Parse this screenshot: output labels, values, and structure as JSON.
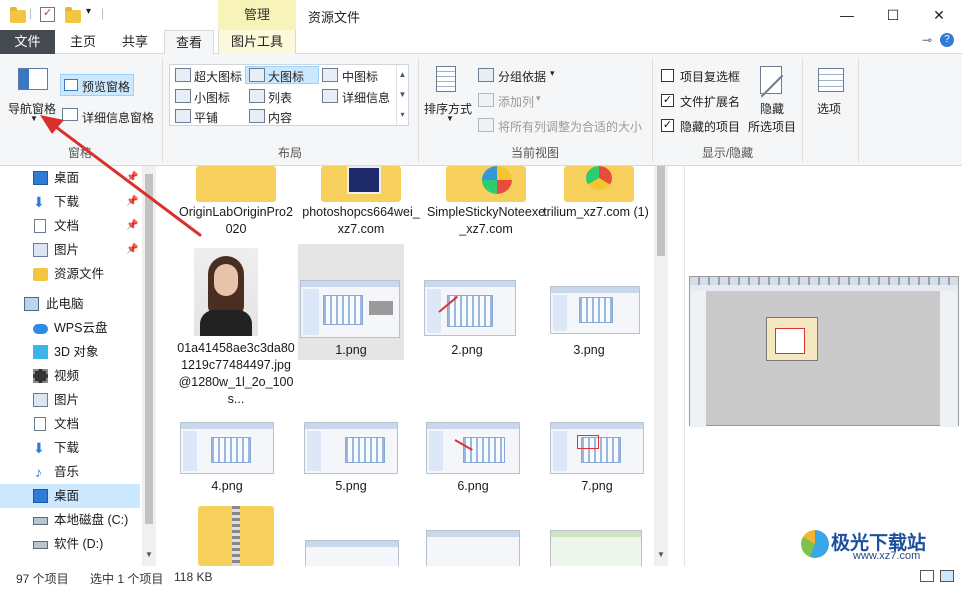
{
  "window": {
    "title": "资源文件",
    "context_tab_header": "管理",
    "minimize": "—",
    "maximize": "☐",
    "close": "✕"
  },
  "tabs": [
    {
      "label": "文件"
    },
    {
      "label": "主页"
    },
    {
      "label": "共享"
    },
    {
      "label": "查看"
    },
    {
      "label": "图片工具"
    }
  ],
  "ribbon": {
    "panes": {
      "label": "窗格",
      "nav_pane": "导航窗格",
      "preview_pane": "预览窗格",
      "details_pane": "详细信息窗格"
    },
    "layout": {
      "label": "布局",
      "items": [
        "超大图标",
        "大图标",
        "中图标",
        "小图标",
        "列表",
        "详细信息",
        "平铺",
        "内容"
      ],
      "selected": "大图标"
    },
    "current_view": {
      "label": "当前视图",
      "sort_by": "排序方式",
      "group_by": "分组依据",
      "add_columns": "添加列",
      "fit_columns": "将所有列调整为合适的大小"
    },
    "show_hide": {
      "label": "显示/隐藏",
      "item_checkboxes": "项目复选框",
      "item_checkboxes_checked": false,
      "file_extensions": "文件扩展名",
      "file_extensions_checked": true,
      "hidden_items": "隐藏的项目",
      "hidden_items_checked": true,
      "hide_selected": "隐藏",
      "hide_selected_2": "所选项目"
    },
    "options": "选项"
  },
  "nav": {
    "items": [
      {
        "label": "桌面",
        "icon": "desktop-icon",
        "pinned": true
      },
      {
        "label": "下载",
        "icon": "download-icon",
        "pinned": true
      },
      {
        "label": "文档",
        "icon": "document-icon",
        "pinned": true
      },
      {
        "label": "图片",
        "icon": "picture-icon",
        "pinned": true
      },
      {
        "label": "资源文件",
        "icon": "folder-icon",
        "pinned": false
      },
      {
        "label": "此电脑",
        "icon": "computer-icon",
        "pinned": false
      },
      {
        "label": "WPS云盘",
        "icon": "cloud-icon",
        "pinned": false
      },
      {
        "label": "3D 对象",
        "icon": "cube-icon",
        "pinned": false
      },
      {
        "label": "视频",
        "icon": "video-icon",
        "pinned": false
      },
      {
        "label": "图片",
        "icon": "picture-icon",
        "pinned": false
      },
      {
        "label": "文档",
        "icon": "document-icon",
        "pinned": false
      },
      {
        "label": "下载",
        "icon": "download-icon",
        "pinned": false
      },
      {
        "label": "音乐",
        "icon": "music-icon",
        "pinned": false
      },
      {
        "label": "桌面",
        "icon": "desktop-icon",
        "pinned": false,
        "selected": true
      },
      {
        "label": "本地磁盘 (C:)",
        "icon": "drive-icon",
        "pinned": false
      },
      {
        "label": "软件 (D:)",
        "icon": "drive-icon",
        "pinned": false
      }
    ]
  },
  "files": [
    {
      "name": "OriginLabOriginPro2020",
      "kind": "folder"
    },
    {
      "name": "photoshopcs664wei_xz7.com",
      "kind": "folder"
    },
    {
      "name": "SimpleStickyNoteexe_xz7.com",
      "kind": "folder"
    },
    {
      "name": "trilium_xz7.com (1)",
      "kind": "folder"
    },
    {
      "name": "01a41458ae3c3da801219c77484497.jpg@1280w_1l_2o_100s...",
      "kind": "photo"
    },
    {
      "name": "1.png",
      "kind": "image",
      "selected": true
    },
    {
      "name": "2.png",
      "kind": "image"
    },
    {
      "name": "3.png",
      "kind": "image"
    },
    {
      "name": "4.png",
      "kind": "image"
    },
    {
      "name": "5.png",
      "kind": "image"
    },
    {
      "name": "6.png",
      "kind": "image"
    },
    {
      "name": "7.png",
      "kind": "image"
    },
    {
      "name": "",
      "kind": "zip"
    },
    {
      "name": "",
      "kind": "image"
    },
    {
      "name": "",
      "kind": "image"
    },
    {
      "name": "",
      "kind": "image"
    }
  ],
  "status": {
    "item_count": "97 个项目",
    "selection": "选中 1 个项目",
    "size": "118 KB"
  },
  "watermark": {
    "brand": "极光下载站",
    "url": "www.xz7.com"
  },
  "colors": {
    "accent_selection": "#cce8ff",
    "file_tab": "#444a4f",
    "context_tab": "#f7f3b9",
    "annotation_arrow": "#d9302c"
  }
}
